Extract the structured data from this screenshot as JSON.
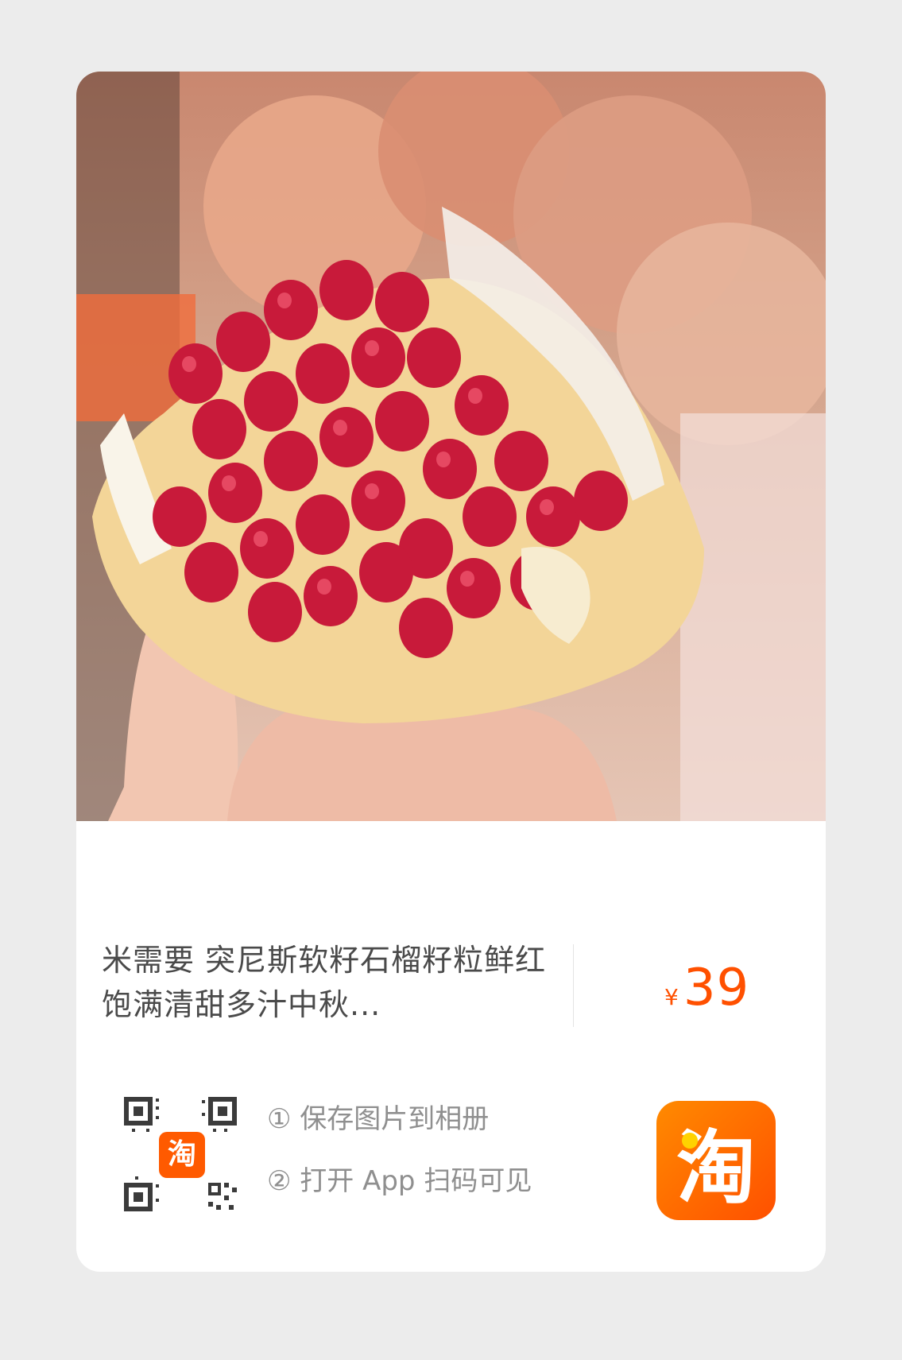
{
  "product": {
    "image_icon": "pomegranate-photo",
    "title": "米需要 突尼斯软籽石榴籽粒鲜红饱满清甜多汁中秋...",
    "currency": "¥",
    "price": "39"
  },
  "share": {
    "qr_icon": "qr-code-icon",
    "qr_badge": "淘",
    "steps": [
      "① 保存图片到相册",
      "② 打开 App 扫码可见"
    ]
  },
  "app_logo": {
    "icon": "taobao-logo-icon",
    "glyph": "淘",
    "accent": "#ff5000"
  }
}
